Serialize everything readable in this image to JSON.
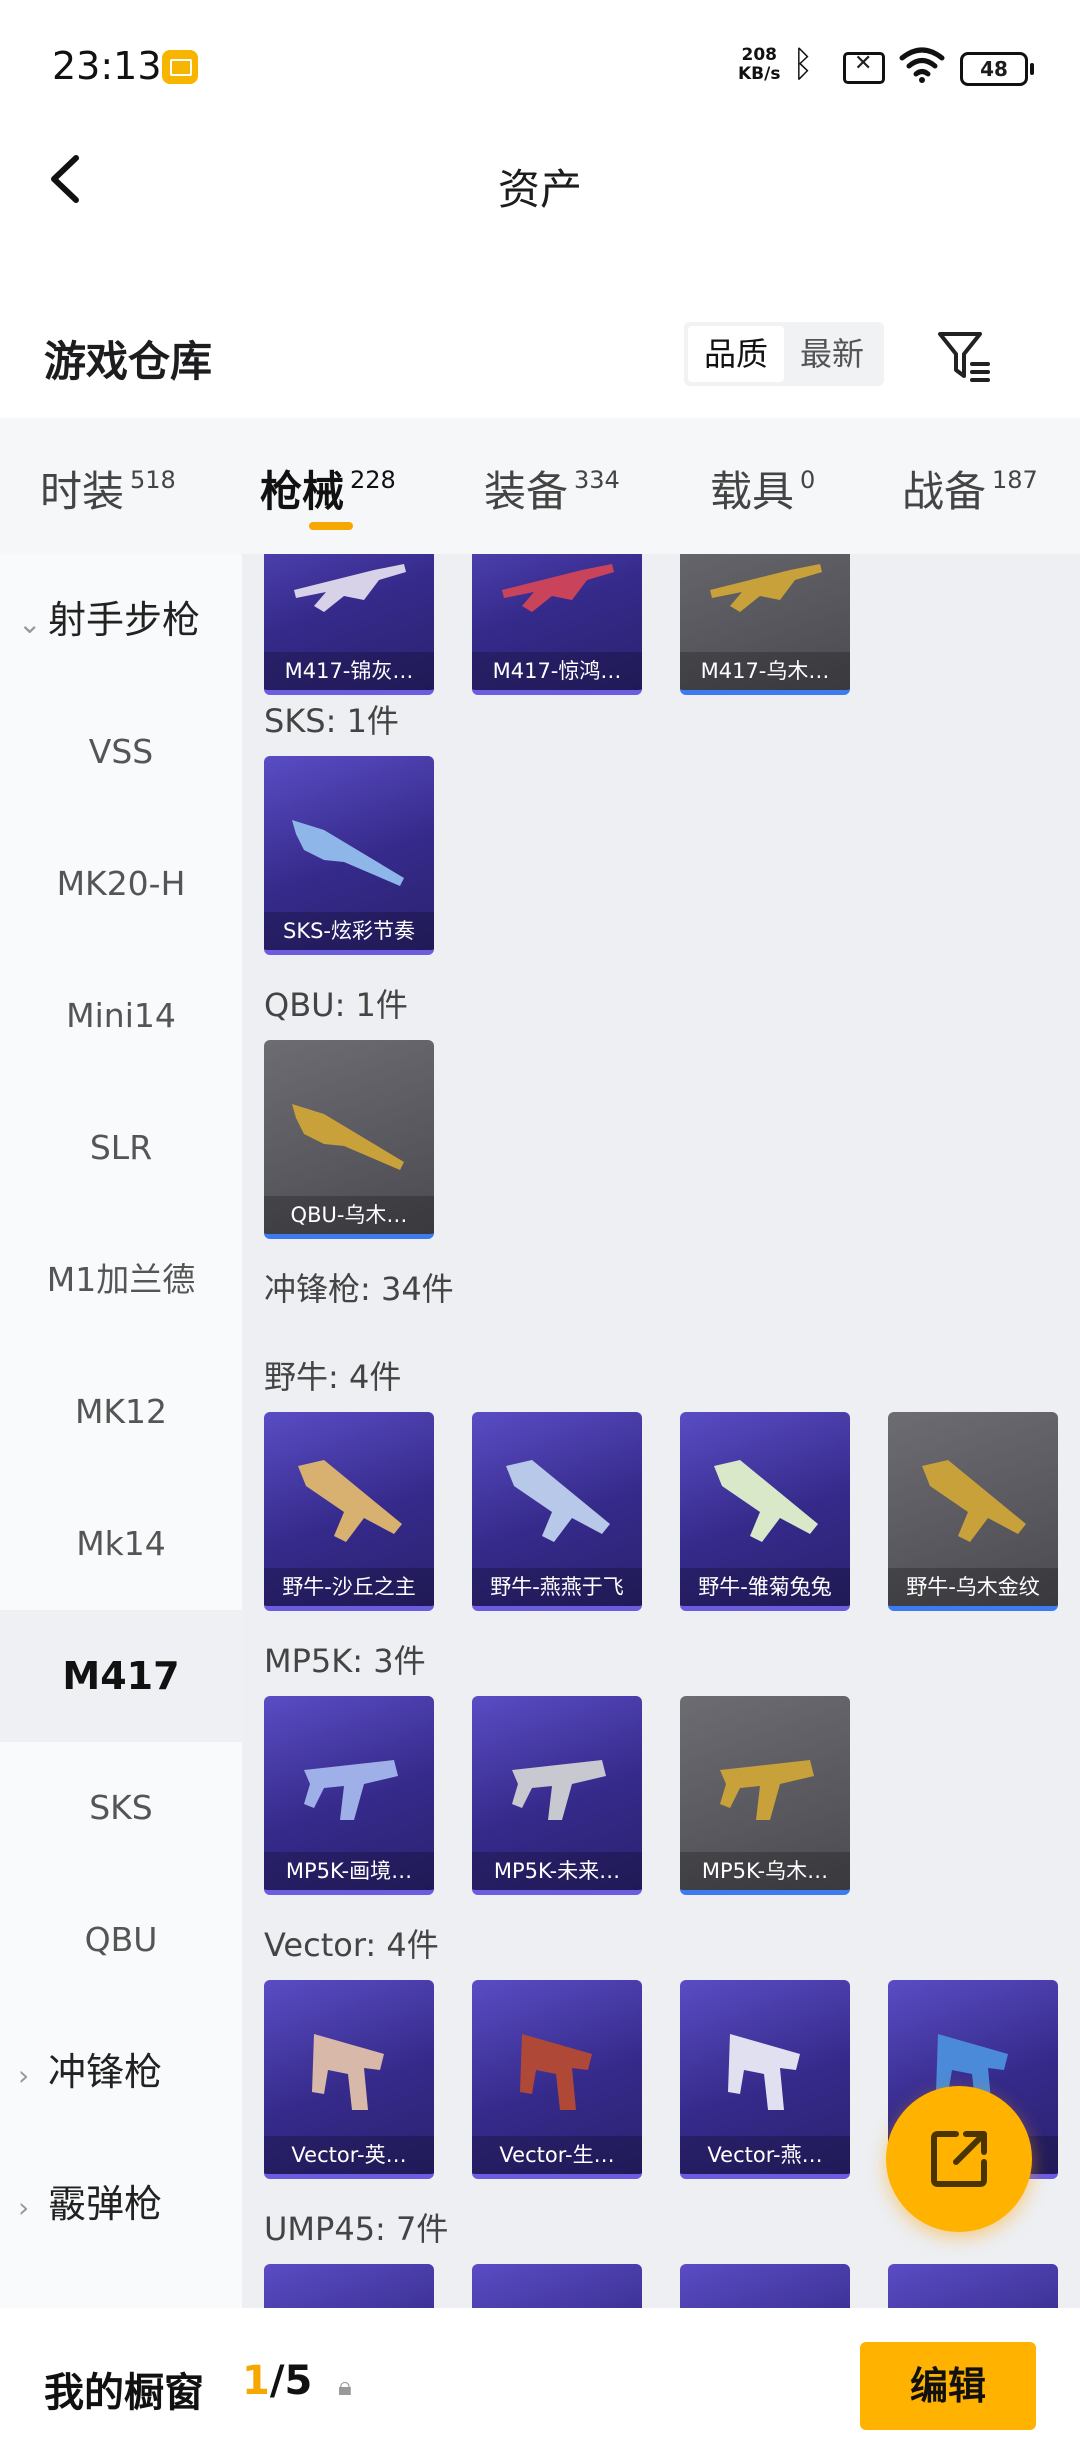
{
  "status_bar": {
    "time": "23:13",
    "net_speed_value": "208",
    "net_speed_unit": "KB/s",
    "battery": "48",
    "icons": [
      "message-icon",
      "bluetooth-icon",
      "sim-off-icon",
      "wifi-icon",
      "battery-icon"
    ]
  },
  "nav": {
    "title": "资产",
    "back_icon": "back-icon"
  },
  "warehouse": {
    "title": "游戏仓库",
    "sort_quality": "品质",
    "sort_latest": "最新",
    "filter_icon": "filter-icon"
  },
  "tabs": [
    {
      "label": "时装",
      "count": "518"
    },
    {
      "label": "枪械",
      "count": "228",
      "active": true
    },
    {
      "label": "装备",
      "count": "334"
    },
    {
      "label": "载具",
      "count": "0"
    },
    {
      "label": "战备",
      "count": "187"
    }
  ],
  "sidebar": {
    "group1": "射手步枪",
    "items": [
      "VSS",
      "MK20-H",
      "Mini14",
      "SLR",
      "M1加兰德",
      "MK12",
      "Mk14",
      "M417",
      "SKS",
      "QBU"
    ],
    "active": "M417",
    "group2": "冲锋枪",
    "group3": "霰弹枪"
  },
  "grid": {
    "m417_cards": [
      "M417-锦灰…",
      "M417-惊鸿…",
      "M417-乌木…"
    ],
    "sks_header": "SKS: 1件",
    "sks_cards": [
      "SKS-炫彩节奏"
    ],
    "qbu_header": "QBU: 1件",
    "qbu_cards": [
      "QBU-乌木…"
    ],
    "smg_header": "冲锋枪: 34件",
    "bizon_header": "野牛: 4件",
    "bizon_cards": [
      "野牛-沙丘之主",
      "野牛-燕燕于飞",
      "野牛-雏菊兔兔",
      "野牛-乌木金纹"
    ],
    "mp5k_header": "MP5K: 3件",
    "mp5k_cards": [
      "MP5K-画境…",
      "MP5K-未来…",
      "MP5K-乌木…"
    ],
    "vector_header": "Vector: 4件",
    "vector_cards": [
      "Vector-英…",
      "Vector-生…",
      "Vector-燕…",
      ""
    ],
    "ump_header": "UMP45: 7件"
  },
  "fab": {
    "icon": "share-icon"
  },
  "bottom": {
    "label": "我的橱窗",
    "current": "1",
    "total": "/5",
    "lock_icon": "lock-icon",
    "edit": "编辑"
  },
  "colors": {
    "accent": "#f7a800",
    "rare_purple": "#352a8a",
    "base_gray": "#4a4a50"
  }
}
